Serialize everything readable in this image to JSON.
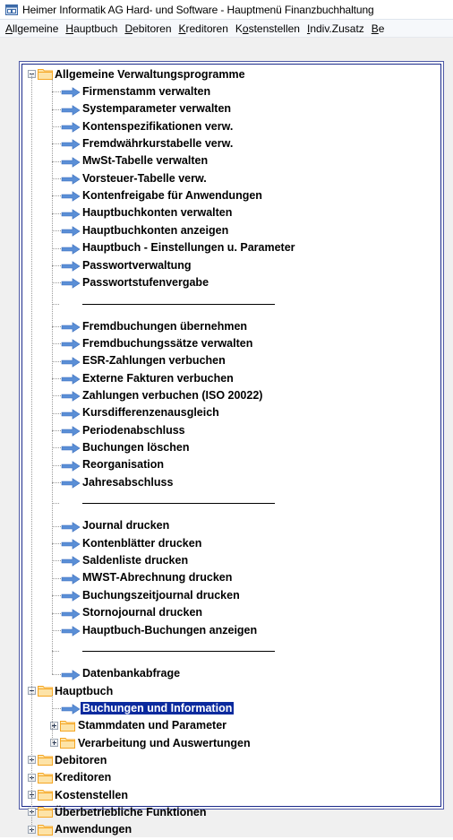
{
  "window": {
    "title": "Heimer Informatik AG Hard- und Software - Hauptmenü Finanzbuchhaltung"
  },
  "menubar": [
    {
      "label": "Allgemeine"
    },
    {
      "label": "Hauptbuch"
    },
    {
      "label": "Debitoren"
    },
    {
      "label": "Kreditoren"
    },
    {
      "label": "Kostenstellen"
    },
    {
      "label": "Indiv.Zusatz"
    },
    {
      "label": "Be"
    }
  ],
  "tree": {
    "root_allgemeine": "Allgemeine Verwaltungsprogramme",
    "allgemeine_items": [
      "Firmenstamm verwalten",
      "Systemparameter verwalten",
      "Kontenspezifikationen verw.",
      "Fremdwährkurstabelle verw.",
      "MwSt-Tabelle verwalten",
      "Vorsteuer-Tabelle verw.",
      "Kontenfreigabe für Anwendungen",
      "Hauptbuchkonten verwalten",
      "Hauptbuchkonten anzeigen",
      "Hauptbuch - Einstellungen u. Parameter",
      "Passwortverwaltung",
      "Passwortstufenvergabe"
    ],
    "buchung_items": [
      "Fremdbuchungen übernehmen",
      "Fremdbuchungssätze verwalten",
      "ESR-Zahlungen verbuchen",
      "Externe Fakturen verbuchen",
      "Zahlungen verbuchen (ISO 20022)",
      "Kursdifferenzenausgleich",
      "Periodenabschluss",
      "Buchungen löschen",
      "Reorganisation",
      "Jahresabschluss"
    ],
    "druck_items": [
      "Journal drucken",
      "Kontenblätter drucken",
      "Saldenliste drucken",
      "MWST-Abrechnung drucken",
      "Buchungszeitjournal drucken",
      "Stornojournal drucken",
      "Hauptbuch-Buchungen anzeigen"
    ],
    "abfrage_item": "Datenbankabfrage",
    "root_hauptbuch": "Hauptbuch",
    "hauptbuch_selected": "Buchungen und Information",
    "hauptbuch_folders": [
      "Stammdaten und Parameter",
      "Verarbeitung und Auswertungen"
    ],
    "other_roots": [
      "Debitoren",
      "Kreditoren",
      "Kostenstellen",
      "Überbetriebliche Funktionen",
      "Anwendungen"
    ]
  },
  "colors": {
    "selection": "#0b2a9e",
    "arrow": "#5b8fd6",
    "folder": "#f5a623"
  }
}
